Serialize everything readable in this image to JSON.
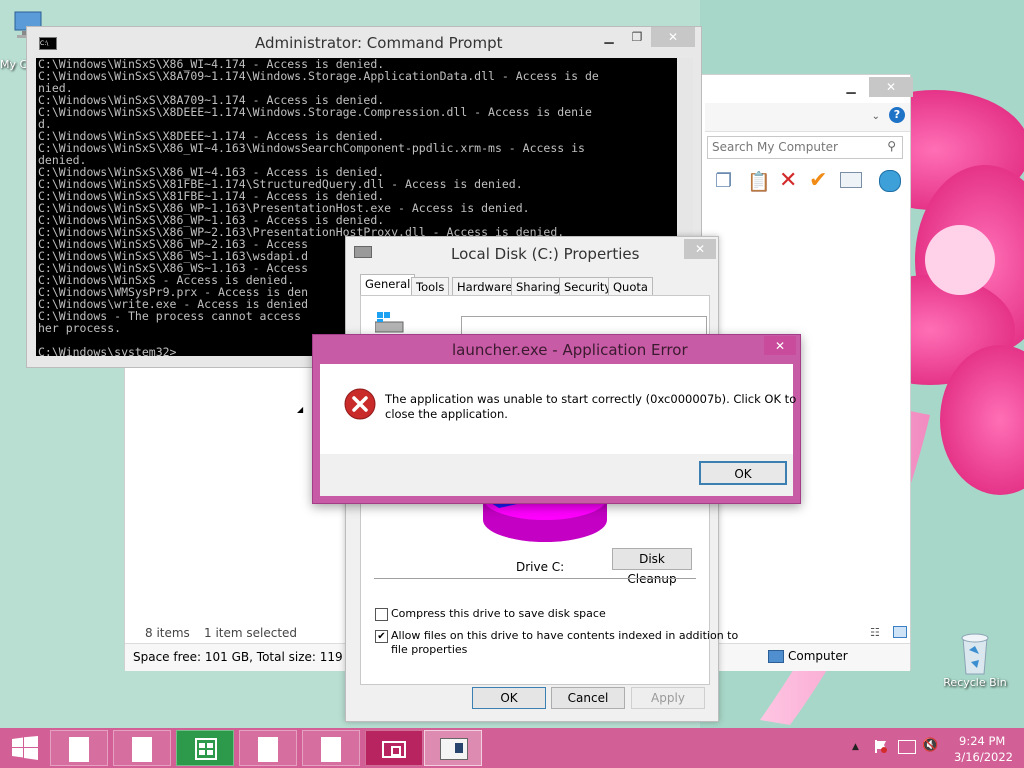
{
  "desktop": {
    "my_computer_label": "My C",
    "recycle_bin_label": "Recycle Bin"
  },
  "cmd": {
    "title": "Administrator: Command Prompt",
    "lines": [
      "C:\\Windows\\WinSxS\\X86_WI~4.174 - Access is denied.",
      "C:\\Windows\\WinSxS\\X8A709~1.174\\Windows.Storage.ApplicationData.dll - Access is de",
      "nied.",
      "C:\\Windows\\WinSxS\\X8A709~1.174 - Access is denied.",
      "C:\\Windows\\WinSxS\\X8DEEE~1.174\\Windows.Storage.Compression.dll - Access is denie",
      "d.",
      "C:\\Windows\\WinSxS\\X8DEEE~1.174 - Access is denied.",
      "C:\\Windows\\WinSxS\\X86_WI~4.163\\WindowsSearchComponent-ppdlic.xrm-ms - Access is",
      "denied.",
      "C:\\Windows\\WinSxS\\X86_WI~4.163 - Access is denied.",
      "C:\\Windows\\WinSxS\\X81FBE~1.174\\StructuredQuery.dll - Access is denied.",
      "C:\\Windows\\WinSxS\\X81FBE~1.174 - Access is denied.",
      "C:\\Windows\\WinSxS\\X86_WP~1.163\\PresentationHost.exe - Access is denied.",
      "C:\\Windows\\WinSxS\\X86_WP~1.163 - Access is denied.",
      "C:\\Windows\\WinSxS\\X86_WP~2.163\\PresentationHostProxy.dll - Access is denied.",
      "C:\\Windows\\WinSxS\\X86_WP~2.163 - Access",
      "C:\\Windows\\WinSxS\\X86_WS~1.163\\wsdapi.d",
      "C:\\Windows\\WinSxS\\X86_WS~1.163 - Access",
      "C:\\Windows\\WinSxS - Access is denied.",
      "C:\\Windows\\WMSysPr9.prx - Access is den",
      "C:\\Windows\\write.exe - Access is denied",
      "C:\\Windows - The process cannot access",
      "her process.",
      "",
      "C:\\Windows\\system32>"
    ]
  },
  "explorer": {
    "search_placeholder": "Search My Computer",
    "status_items": "8 items",
    "status_selected": "1 item selected",
    "space_info": "Space free: 101 GB, Total size: 119 GB",
    "location": "Computer"
  },
  "props": {
    "title": "Local Disk (C:) Properties",
    "tabs": [
      "General",
      "Tools",
      "Hardware",
      "Sharing",
      "Security",
      "Quota"
    ],
    "drive_label": "Drive C:",
    "disk_cleanup": "Disk Cleanup",
    "compress_label": "Compress this drive to save disk space",
    "index_label_1": "Allow files on this drive to have contents indexed in addition to",
    "index_label_2": "file properties",
    "ok": "OK",
    "cancel": "Cancel",
    "apply": "Apply"
  },
  "error": {
    "title": "launcher.exe - Application Error",
    "message_1": "The application was unable to start correctly (0xc000007b). Click OK to",
    "message_2": "close the application.",
    "ok": "OK"
  },
  "taskbar": {
    "time": "9:24 PM",
    "date": "3/16/2022"
  },
  "colors": {
    "taskbar": "#d25f95",
    "error_frame": "#c85ba6",
    "pie_used": "#ff00ff",
    "pie_free": "#1b1bff"
  }
}
